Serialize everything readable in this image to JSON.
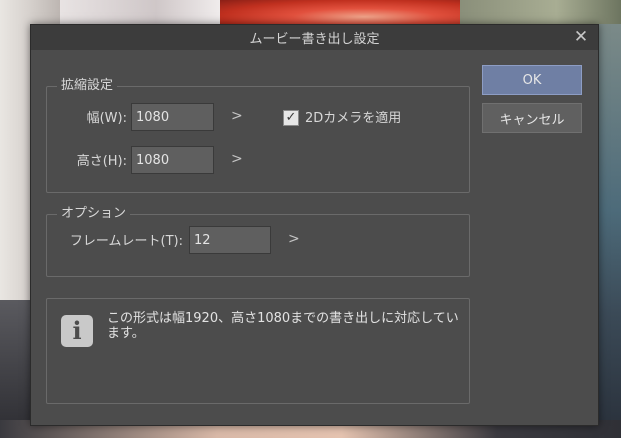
{
  "dialog": {
    "title": "ムービー書き出し設定"
  },
  "scale_group": {
    "legend": "拡縮設定",
    "width_label": "幅(W):",
    "width_value": "1080",
    "height_label": "高さ(H):",
    "height_value": "1080",
    "apply_2d_camera_label": "2Dカメラを適用",
    "apply_2d_camera_checked": true
  },
  "options_group": {
    "legend": "オプション",
    "framerate_label": "フレームレート(T):",
    "framerate_value": "12"
  },
  "info": {
    "text": "この形式は幅1920、高さ1080までの書き出しに対応しています。"
  },
  "buttons": {
    "ok": "OK",
    "cancel": "キャンセル"
  },
  "icons": {
    "close": "close-icon",
    "chevron": "chevron-right-icon",
    "info": "info-icon",
    "check": "checkmark-icon"
  },
  "colors": {
    "dialog_bg": "#4c4c4c",
    "title_bg": "#3c3c3c",
    "ok_button": "#6f7fa4"
  }
}
